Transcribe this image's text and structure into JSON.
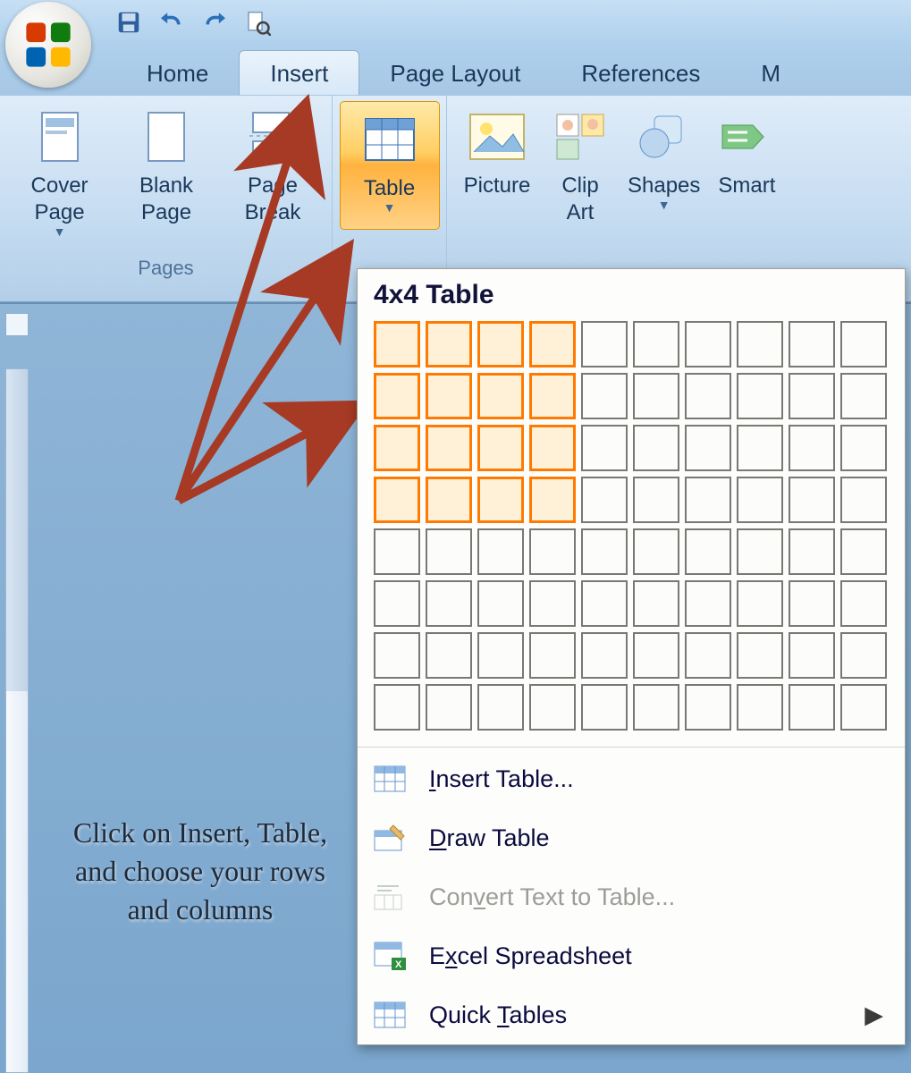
{
  "quick_access": {
    "items": [
      "save",
      "undo",
      "redo",
      "print-preview"
    ]
  },
  "tabs": {
    "home": "Home",
    "insert": "Insert",
    "page_layout": "Page Layout",
    "references": "References",
    "more": "M"
  },
  "ribbon": {
    "pages": {
      "cover_page": "Cover Page",
      "blank_page": "Blank Page",
      "page_break": "Page Break",
      "group_label": "Pages"
    },
    "tables": {
      "table": "Table"
    },
    "illustrations": {
      "picture": "Picture",
      "clip_art_l1": "Clip",
      "clip_art_l2": "Art",
      "shapes": "Shapes",
      "smart": "Smart"
    }
  },
  "table_dropdown": {
    "title": "4x4 Table",
    "grid": {
      "cols": 10,
      "rows": 8,
      "sel_cols": 4,
      "sel_rows": 4
    },
    "menu": {
      "insert_table": "Insert Table...",
      "draw_table": "Draw Table",
      "convert": "Convert Text to Table...",
      "excel": "Excel Spreadsheet",
      "quick_tables": "Quick Tables"
    }
  },
  "annotation": {
    "text": "Click on Insert, Table, and choose your rows and columns"
  },
  "colors": {
    "highlight": "#ff7a00",
    "arrow": "#a63a24"
  }
}
